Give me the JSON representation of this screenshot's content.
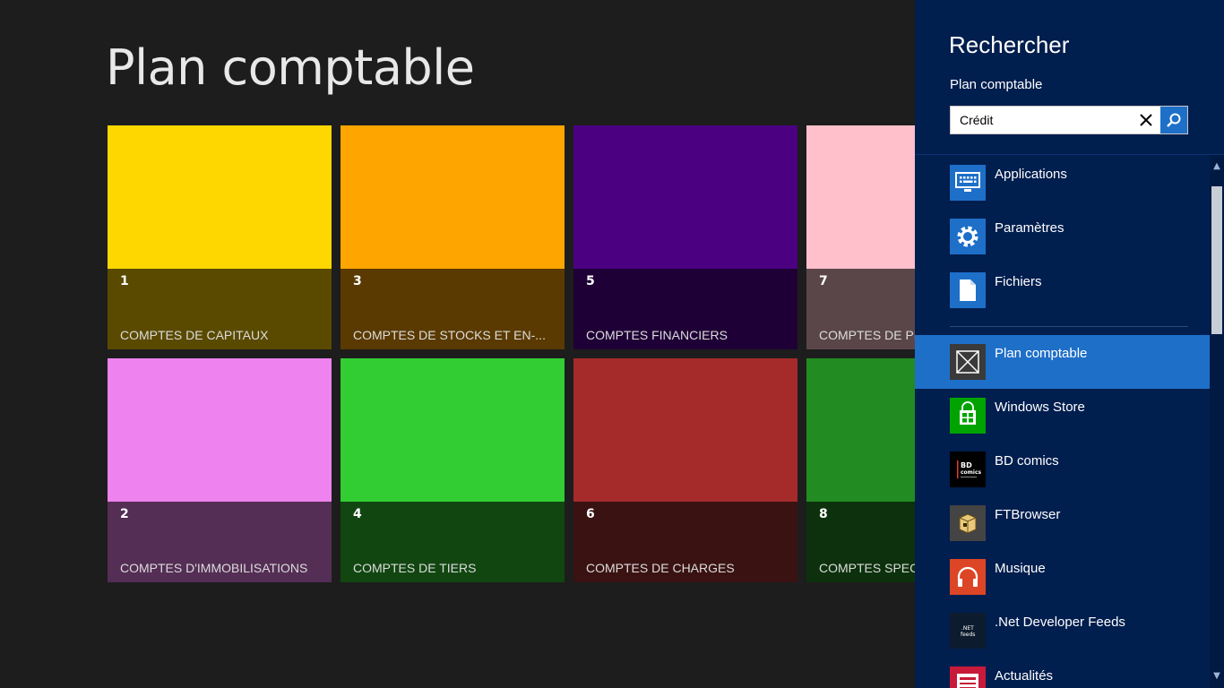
{
  "page": {
    "title": "Plan comptable"
  },
  "tiles": [
    {
      "number": "1",
      "label": "COMPTES DE CAPITAUX",
      "color": "#ffd700",
      "band": "#5a4a00"
    },
    {
      "number": "3",
      "label": "COMPTES DE STOCKS ET EN-...",
      "color": "#ffa500",
      "band": "#5a3a00"
    },
    {
      "number": "5",
      "label": "COMPTES FINANCIERS",
      "color": "#4b0082",
      "band": "#1f0036"
    },
    {
      "number": "7",
      "label": "COMPTES DE PR",
      "color": "#ffc0cb",
      "band": "#5a4649"
    },
    {
      "number": "2",
      "label": "COMPTES D'IMMOBILISATIONS",
      "color": "#ee82ee",
      "band": "#542e55"
    },
    {
      "number": "4",
      "label": "COMPTES DE TIERS",
      "color": "#32cd32",
      "band": "#114611"
    },
    {
      "number": "6",
      "label": "COMPTES DE CHARGES",
      "color": "#a52a2a",
      "band": "#3a1212"
    },
    {
      "number": "8",
      "label": "COMPTES SPECI",
      "color": "#228b22",
      "band": "#0c310c"
    }
  ],
  "search_pane": {
    "title": "Rechercher",
    "scope": "Plan comptable",
    "query": "Crédit",
    "categories": [
      {
        "label": "Applications",
        "icon": "keyboard-icon",
        "color": "#1e6fc8"
      },
      {
        "label": "Paramètres",
        "icon": "gear-icon",
        "color": "#1e6fc8"
      },
      {
        "label": "Fichiers",
        "icon": "document-icon",
        "color": "#1e6fc8"
      }
    ],
    "apps": [
      {
        "label": "Plan comptable",
        "icon": "placeholder-icon",
        "color": "#3a3a3a"
      },
      {
        "label": "Windows Store",
        "icon": "store-bag-icon",
        "color": "#00a300"
      },
      {
        "label": "BD comics",
        "icon": "bd-comics-logo-icon",
        "color": "#000000"
      },
      {
        "label": "FTBrowser",
        "icon": "ftbrowser-box-icon",
        "color": "#444444"
      },
      {
        "label": "Musique",
        "icon": "headphones-icon",
        "color": "#dc4626"
      },
      {
        "label": ".Net Developer Feeds",
        "icon": "net-feeds-icon",
        "color": "#0d1b2e"
      },
      {
        "label": "Actualités",
        "icon": "news-icon",
        "color": "#c81a3a"
      }
    ],
    "selected_app": "Plan comptable"
  }
}
